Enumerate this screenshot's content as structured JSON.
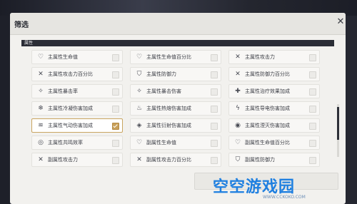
{
  "panel": {
    "title": "筛选"
  },
  "section": {
    "label": "属性"
  },
  "items": [
    {
      "label": "主属性生命值",
      "icon": "heart-icon",
      "checked": false
    },
    {
      "label": "主属性生命值百分比",
      "icon": "heart-icon",
      "checked": false
    },
    {
      "label": "主属性攻击力",
      "icon": "crossed-swords-icon",
      "checked": false
    },
    {
      "label": "主属性攻击力百分比",
      "icon": "crossed-swords-icon",
      "checked": false
    },
    {
      "label": "主属性防御力",
      "icon": "shield-icon",
      "checked": false
    },
    {
      "label": "主属性防御力百分比",
      "icon": "crossed-swords-icon",
      "checked": false
    },
    {
      "label": "主属性暴击率",
      "icon": "sparkle-icon",
      "checked": false
    },
    {
      "label": "主属性暴击伤害",
      "icon": "sparkle-icon",
      "checked": false
    },
    {
      "label": "主属性治疗效果加成",
      "icon": "plus-icon",
      "checked": false
    },
    {
      "label": "主属性冷凝伤害加成",
      "icon": "snowflake-icon",
      "checked": false
    },
    {
      "label": "主属性热熔伤害加成",
      "icon": "flame-icon",
      "checked": false
    },
    {
      "label": "主属性导电伤害加成",
      "icon": "lightning-icon",
      "checked": false
    },
    {
      "label": "主属性气动伤害加成",
      "icon": "wind-icon",
      "checked": true
    },
    {
      "label": "主属性衍射伤害加成",
      "icon": "diffraction-icon",
      "checked": false
    },
    {
      "label": "主属性湮灭伤害加成",
      "icon": "annihilation-icon",
      "checked": false
    },
    {
      "label": "主属性共鸣效率",
      "icon": "resonance-icon",
      "checked": false
    },
    {
      "label": "副属性生命值",
      "icon": "heart-icon",
      "checked": false
    },
    {
      "label": "副属性生命值百分比",
      "icon": "heart-icon",
      "checked": false
    },
    {
      "label": "副属性攻击力",
      "icon": "crossed-swords-icon",
      "checked": false
    },
    {
      "label": "副属性攻击力百分比",
      "icon": "crossed-swords-icon",
      "checked": false
    },
    {
      "label": "副属性防御力",
      "icon": "shield-icon",
      "checked": false
    }
  ],
  "watermark": {
    "text": "空空游戏园",
    "url": "WWW.CCKOKO.COM"
  },
  "colors": {
    "accent": "#c8a05a",
    "section_bar": "#2b2d36",
    "watermark": "#1e7fe0"
  }
}
